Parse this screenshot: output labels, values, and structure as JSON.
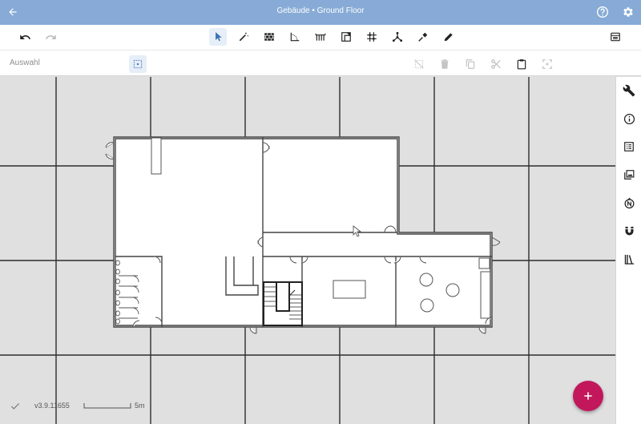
{
  "header": {
    "title": "Gebäude • Ground Floor",
    "back_icon": "arrow-left-icon",
    "help_icon": "help-circle-icon",
    "settings_icon": "gear-icon"
  },
  "toolbar": {
    "undo_icon": "undo-icon",
    "redo_icon": "redo-icon",
    "tools": [
      {
        "name": "select-tool",
        "icon": "cursor-arrow-icon",
        "active": true
      },
      {
        "name": "magic-wand-tool",
        "icon": "magic-wand-icon",
        "active": false
      },
      {
        "name": "wall-tool",
        "icon": "brick-wall-icon",
        "active": false
      },
      {
        "name": "room-tool",
        "icon": "room-corner-icon",
        "active": false
      },
      {
        "name": "stairs-tool",
        "icon": "stairs-icon",
        "active": false
      },
      {
        "name": "door-tool",
        "icon": "door-icon",
        "active": false
      },
      {
        "name": "column-tool",
        "icon": "column-grid-icon",
        "active": false
      },
      {
        "name": "graph-tool",
        "icon": "graph-nodes-icon",
        "active": false
      },
      {
        "name": "measure-tool",
        "icon": "pin-tool-icon",
        "active": false
      },
      {
        "name": "draw-tool",
        "icon": "pencil-icon",
        "active": false
      }
    ],
    "layers_icon": "layers-panel-icon"
  },
  "subbar": {
    "label": "Auswahl",
    "select_area_icon": "select-area-icon",
    "actions": [
      "deselect-icon",
      "delete-icon",
      "copy-icon",
      "cut-icon",
      "paste-icon",
      "center-focus-icon"
    ]
  },
  "rightbar": {
    "icons": [
      "wrench-icon",
      "info-icon",
      "list-icon",
      "image-layer-icon",
      "compass-north-icon",
      "magnet-icon",
      "library-icon"
    ]
  },
  "footer": {
    "status_icon": "check-icon",
    "version": "v3.9.11655",
    "scale_label": "5m"
  },
  "fab": {
    "label": "+"
  },
  "colors": {
    "header": "#87abd6",
    "accent": "#c2185b",
    "grid": "#2b2b2b"
  }
}
